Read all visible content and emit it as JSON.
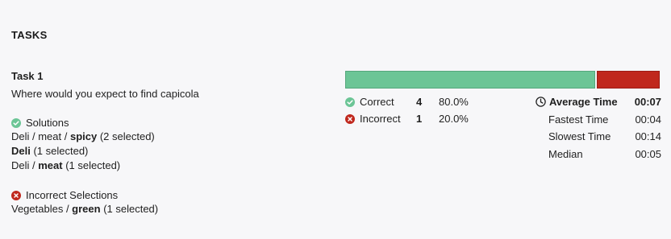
{
  "section": {
    "title": "TASKS"
  },
  "task": {
    "title": "Task 1",
    "question": "Where would you expect to find capicola"
  },
  "solutions": {
    "header": "Solutions",
    "items": [
      {
        "prefix": "Deli / meat / ",
        "bold": "spicy",
        "suffix": " (2 selected)"
      },
      {
        "prefix": "",
        "bold": "Deli",
        "suffix": " (1 selected)"
      },
      {
        "prefix": "Deli / ",
        "bold": "meat",
        "suffix": " (1 selected)"
      }
    ]
  },
  "incorrect": {
    "header": "Incorrect Selections",
    "items": [
      {
        "prefix": "Vegetables / ",
        "bold": "green",
        "suffix": " (1 selected)"
      }
    ]
  },
  "results": {
    "correct": {
      "label": "Correct",
      "count": "4",
      "percent": "80.0%",
      "fraction": 0.8
    },
    "incorrect": {
      "label": "Incorrect",
      "count": "1",
      "percent": "20.0%",
      "fraction": 0.2
    }
  },
  "times": {
    "average": {
      "label": "Average Time",
      "value": "00:07"
    },
    "fastest": {
      "label": "Fastest Time",
      "value": "00:04"
    },
    "slowest": {
      "label": "Slowest Time",
      "value": "00:14"
    },
    "median": {
      "label": "Median",
      "value": "00:05"
    }
  },
  "colors": {
    "correct": "#6cc596",
    "incorrect": "#c0281d",
    "background": "#f7f7f9"
  },
  "icons": {
    "correct": "check-circle-icon",
    "incorrect": "x-circle-icon",
    "clock": "clock-icon"
  }
}
